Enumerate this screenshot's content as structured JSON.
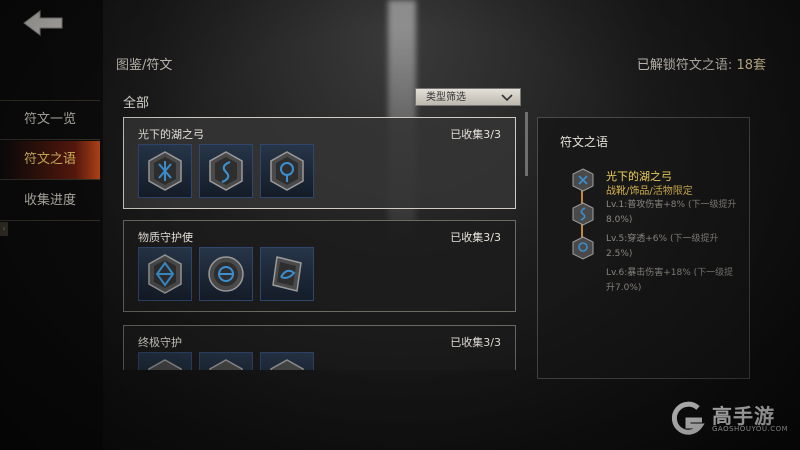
{
  "sidebar": {
    "items": [
      {
        "label": "符文一览"
      },
      {
        "label": "符文之语"
      },
      {
        "label": "收集进度"
      }
    ],
    "expand_glyph": "›"
  },
  "header": {
    "breadcrumb": "图鉴/符文",
    "unlocked_label": "已解锁符文之语:",
    "unlocked_value": "18套"
  },
  "filter": {
    "all_label": "全部",
    "dropdown_label": "类型筛选"
  },
  "runeword_list": [
    {
      "title": "光下的湖之弓",
      "count": "已收集3/3",
      "selected": true
    },
    {
      "title": "物质守护使",
      "count": "已收集3/3",
      "selected": false
    },
    {
      "title": "终极守护",
      "count": "已收集3/3",
      "selected": false
    }
  ],
  "detail": {
    "panel_title": "符文之语",
    "name": "光下的湖之弓",
    "subtitle": "战靴/饰品/活物限定",
    "bonuses": [
      "Lv.1:普攻伤害+8% (下一级提升8.0%)",
      "Lv.5:穿透+6% (下一级提升2.5%)",
      "Lv.6:暴击伤害+18% (下一级提升7.0%)"
    ]
  },
  "watermark": {
    "brand": "高手游",
    "site": "GAOSHOUYOU.COM"
  },
  "colors": {
    "accent_gold": "#f2d45a",
    "active_red": "#aa280f",
    "rune_blue": "#3a8fd0"
  }
}
